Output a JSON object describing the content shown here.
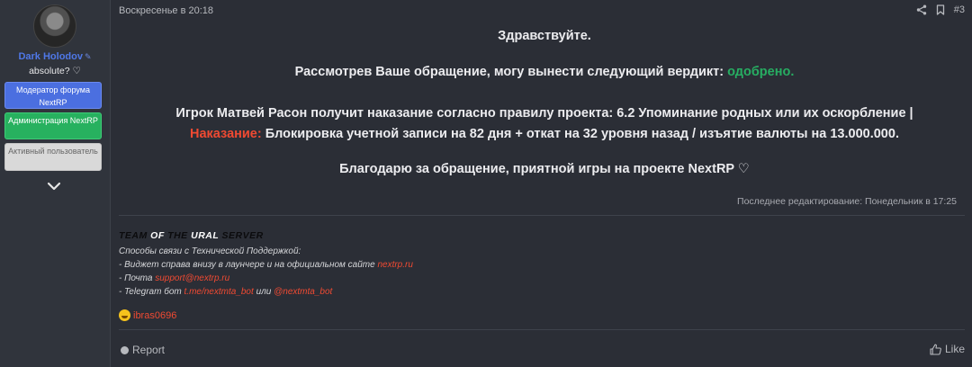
{
  "post": {
    "timestamp": "Воскресенье в 20:18",
    "number": "#3",
    "greeting": "Здравствуйте.",
    "verdict_prefix": "Рассмотрев Ваше обращение, могу вынести следующий вердикт:",
    "verdict_value": "одобрено.",
    "penalty_line1": "Игрок Матвей Расон получит наказание согласно правилу проекта: 6.2 Упоминание родных или их оскорбление |",
    "penalty_label": "Наказание:",
    "penalty_text": "Блокировка учетной записи на 82 дня + откат на 32 уровня назад / изъятие валюты на 13.000.000.",
    "thanks": "Благодарю за обращение, приятной игры на проекте NextRP ♡",
    "last_edit": "Последнее редактирование: Понедельник в 17:25"
  },
  "author": {
    "name": "Dark Holodov",
    "title": "absolute? ♡",
    "badges": [
      "Модератор форума NextRP",
      "Администрация NextRP",
      "Активный пользователь"
    ]
  },
  "signature": {
    "team_words": [
      "TEAM",
      "OF",
      "THE",
      "URAL",
      "SERVER"
    ],
    "line1": "Способы связи с Технической Поддержкой:",
    "line2_prefix": "- Виджет справа внизу в лаунчере и на официальном сайте",
    "line2_link": "nextrp.ru",
    "line3_prefix": "- Почта",
    "line3_link": "support@nextrp.ru",
    "line4_prefix": "- Telegram бот",
    "line4_link1": "t.me/nextmta_bot",
    "line4_mid": "или",
    "line4_link2": "@nextmta_bot"
  },
  "reactions": {
    "user": "ibras0696"
  },
  "footer": {
    "report_label": "Report",
    "like_label": "Like"
  },
  "colors": {
    "verdict": "#27ad62",
    "penalty": "#f04a32",
    "link": "#f04a32",
    "username": "#4f78e8"
  },
  "icons": [
    "share-icon",
    "bookmark-icon",
    "chevron-down-icon",
    "report-icon",
    "like-icon",
    "laughing-emoji-icon"
  ]
}
